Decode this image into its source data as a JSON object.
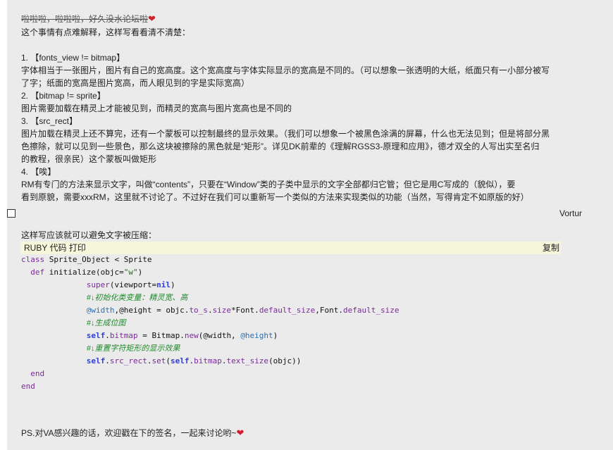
{
  "post": {
    "intro_strike": "啦啦啦，啦啦啦，好久没水论坛啦",
    "intro_line2": "这个事情有点难解释，这样写看看清不清楚：",
    "items": [
      {
        "head": "1. 【fonts_view != bitmap】",
        "body": [
          "  字体相当于一张图片，图片有自己的宽高度。这个宽高度与字体实际显示的宽高是不同的。（可以想象一张透明的大纸，纸面只有一小部分被写",
          "了字；纸面的宽高是图片宽高，而人眼见到的字是实际宽高）"
        ]
      },
      {
        "head": "2. 【bitmap != sprite】",
        "body": [
          "  图片需要加载在精灵上才能被见到，而精灵的宽高与图片宽高也是不同的"
        ]
      },
      {
        "head": "3. 【src_rect】",
        "body": [
          "  图片加载在精灵上还不算完，还有一个蒙板可以控制最终的显示效果。（我们可以想象一个被黑色涂满的屏幕，什么也无法见到；但是将部分黑",
          "色擦除，就可以见到一些景色，那么这块被擦除的黑色就是“矩形”。详见DK前辈的《理解RGSS3-原理和应用》，德才双全的人写出实至名归",
          "的教程，很亲民）这个蒙板叫做矩形"
        ]
      },
      {
        "head": "4. 【唉】",
        "body": [
          "  RM有专门的方法来显示文字，叫做“contents”，只要在“Window”类的子类中显示的文字全部都归它管；但它是用C写成的（貌似），要",
          "看到原貌，需要xxxRM，这里就不讨论了。不过好在我们可以重新写一个类似的方法来实现类似的功能（当然，写得肯定不如原版的好）"
        ]
      }
    ],
    "image_alt": "Vortur",
    "summary_line": "这样写应该就可以避免文字被压缩：",
    "code_header": {
      "lang": "RUBY 代码",
      "print": "打印",
      "copy": "复制"
    },
    "code": {
      "l1": [
        "class",
        " Sprite_Object < Sprite"
      ],
      "l2": [
        "def",
        " initialize(objc=",
        "\"w\"",
        ")"
      ],
      "l3": [
        "super",
        "(viewport=",
        "nil",
        ")"
      ],
      "l4": "#↓初始化类变量：精灵宽、高",
      "l5": [
        "@width",
        ",@height = objc.",
        "to_s",
        ".",
        "size",
        "*Font.",
        "default_size",
        ",Font.",
        "default_size"
      ],
      "l6": "#↓生成位图",
      "l7": [
        "self",
        ".",
        "bitmap",
        " = Bitmap.",
        "new",
        "(@width, ",
        "@height",
        ")"
      ],
      "l8": "#↓重置字符矩形的显示效果",
      "l9": [
        "self",
        ".",
        "src_rect",
        ".",
        "set",
        "(",
        "self",
        ".",
        "bitmap",
        ".",
        "text_size",
        "(objc))"
      ],
      "l10": "end",
      "l11": "end"
    },
    "signature": "PS.对VA感兴趣的话，欢迎戳在下的签名，一起来讨论哟~",
    "heart": "❤"
  }
}
